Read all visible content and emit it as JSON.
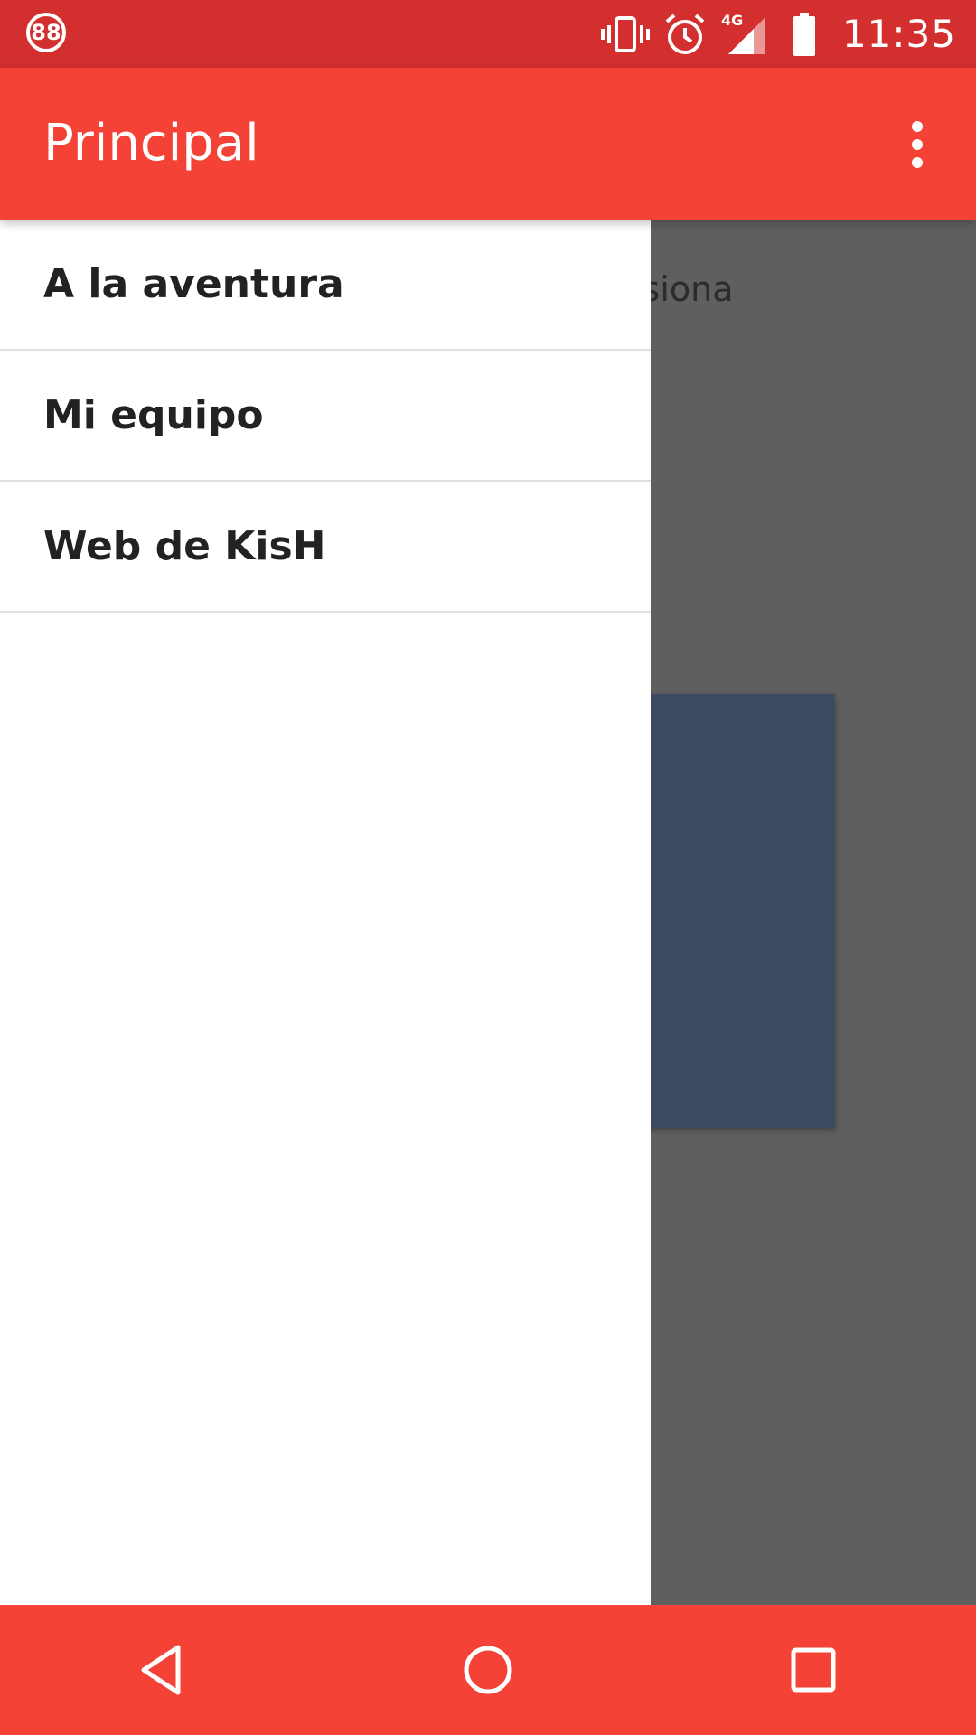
{
  "status_bar": {
    "notification_badge": "88",
    "time": "11:35",
    "network_label": "4G",
    "icons": [
      "vibrate-icon",
      "alarm-icon",
      "signal-icon",
      "battery-icon"
    ]
  },
  "app_bar": {
    "title": "Principal",
    "overflow_icon": "more-vert-icon",
    "color": "#f44336"
  },
  "content": {
    "partial_text": "n, presiona",
    "card_color": "#3d4a62"
  },
  "drawer": {
    "items": [
      {
        "label": "A la aventura"
      },
      {
        "label": "Mi equipo"
      },
      {
        "label": "Web de KisH"
      }
    ]
  },
  "nav_bar": {
    "buttons": [
      "back-icon",
      "home-icon",
      "recents-icon"
    ],
    "color": "#f44336"
  },
  "colors": {
    "status_bar": "#d32f2f",
    "scrim": "#5f5f5f"
  }
}
